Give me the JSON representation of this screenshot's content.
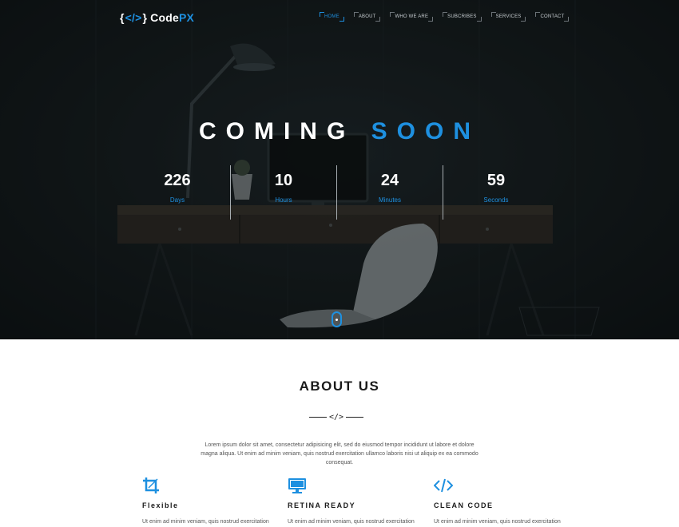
{
  "brand": {
    "open_brace": "{",
    "code_symbol": "</>",
    "close_brace": "}",
    "name_main": "Code",
    "name_accent": "PX"
  },
  "nav": {
    "items": [
      {
        "label": "HOME",
        "active": true
      },
      {
        "label": "ABOUT",
        "active": false
      },
      {
        "label": "WHO WE ARE",
        "active": false
      },
      {
        "label": "SUBCRIBES",
        "active": false
      },
      {
        "label": "SERVICES",
        "active": false
      },
      {
        "label": "CONTACT",
        "active": false
      }
    ]
  },
  "hero": {
    "headline_main": "COMING",
    "headline_accent": "SOON",
    "countdown": [
      {
        "value": "226",
        "label": "Days"
      },
      {
        "value": "10",
        "label": "Hours"
      },
      {
        "value": "24",
        "label": "Minutes"
      },
      {
        "value": "59",
        "label": "Seconds"
      }
    ]
  },
  "about": {
    "title": "ABOUT US",
    "separator_symbol": "</>",
    "text": "Lorem ipsum dolor sit amet, consectetur adipisicing elit, sed do eiusmod tempor incididunt ut labore et dolore magna aliqua. Ut enim ad minim veniam, quis nostrud exercitation ullamco laboris nisi ut aliquip ex ea commodo consequat.",
    "features": [
      {
        "icon": "crop-icon",
        "title": "Flexible",
        "text": "Ut enim ad minim veniam, quis nostrud exercitation"
      },
      {
        "icon": "monitor-icon",
        "title": "RETINA READY",
        "text": "Ut enim ad minim veniam, quis nostrud exercitation"
      },
      {
        "icon": "code-icon",
        "title": "CLEAN CODE",
        "text": "Ut enim ad minim veniam, quis nostrud exercitation"
      }
    ]
  },
  "colors": {
    "accent": "#1e90e0",
    "hero_bg": "#14191c",
    "text_dark": "#1a1a1a"
  }
}
